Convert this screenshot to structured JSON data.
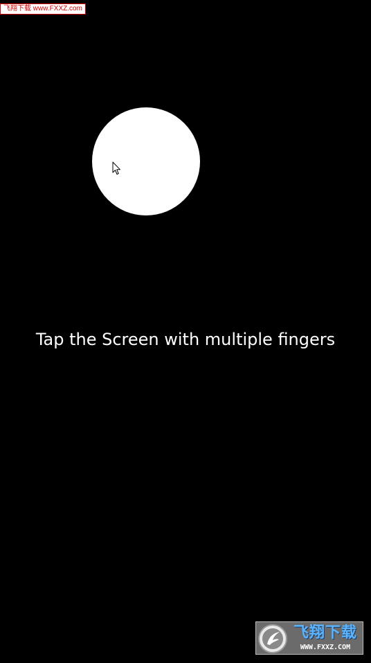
{
  "watermark_top": {
    "text": "飞翔下载 www.FXXZ.com"
  },
  "canvas": {
    "instruction": "Tap the Screen with multiple fingers",
    "background_color": "#000000",
    "touch_color": "#ffffff"
  },
  "watermark_bottom": {
    "title": "飞翔下载",
    "url": "WWW.FXXZ.COM",
    "logo_icon": "fxxz-logo-icon"
  },
  "cursor": {
    "icon": "mouse-pointer-icon"
  }
}
